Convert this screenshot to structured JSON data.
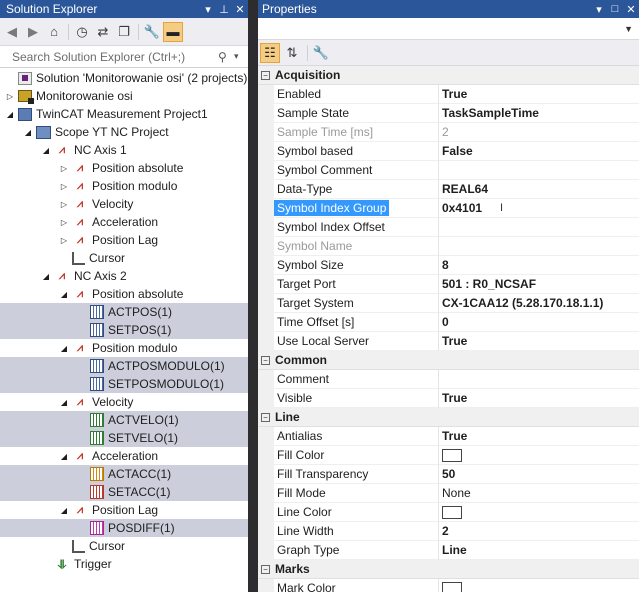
{
  "solution_explorer": {
    "title": "Solution Explorer",
    "pin_icon": "pin-icon",
    "close_icon": "close-icon",
    "search_placeholder": "Search Solution Explorer (Ctrl+;)",
    "tree": [
      {
        "label": "Solution 'Monitorowanie osi' (2 projects)",
        "icon": "solution-icon",
        "level": 0,
        "expander": "none",
        "selected": false
      },
      {
        "label": "Monitorowanie osi",
        "icon": "plc-project-icon",
        "level": 0,
        "expander": "collapsed",
        "selected": false
      },
      {
        "label": "TwinCAT Measurement Project1",
        "icon": "measurement-project-icon",
        "level": 0,
        "expander": "expanded",
        "selected": false
      },
      {
        "label": "Scope YT NC Project",
        "icon": "scope-icon",
        "level": 1,
        "expander": "expanded",
        "selected": false
      },
      {
        "label": "NC Axis 1",
        "icon": "axis-icon",
        "level": 2,
        "expander": "expanded",
        "selected": false
      },
      {
        "label": "Position absolute",
        "icon": "channel-icon",
        "level": 3,
        "expander": "collapsed",
        "selected": false
      },
      {
        "label": "Position modulo",
        "icon": "channel-icon",
        "level": 3,
        "expander": "collapsed",
        "selected": false
      },
      {
        "label": "Velocity",
        "icon": "channel-icon",
        "level": 3,
        "expander": "collapsed",
        "selected": false
      },
      {
        "label": "Acceleration",
        "icon": "channel-icon",
        "level": 3,
        "expander": "collapsed",
        "selected": false
      },
      {
        "label": "Position Lag",
        "icon": "channel-icon",
        "level": 3,
        "expander": "collapsed",
        "selected": false
      },
      {
        "label": "Cursor",
        "icon": "cursor-icon",
        "level": 3,
        "expander": "none",
        "selected": false
      },
      {
        "label": "NC Axis 2",
        "icon": "axis-icon",
        "level": 2,
        "expander": "expanded",
        "selected": false
      },
      {
        "label": "Position absolute",
        "icon": "channel-icon",
        "level": 3,
        "expander": "expanded",
        "selected": false
      },
      {
        "label": "ACTPOS(1)",
        "icon": "acquisition-blue-icon",
        "level": 4,
        "expander": "none",
        "selected": true
      },
      {
        "label": "SETPOS(1)",
        "icon": "acquisition-blue-icon",
        "level": 4,
        "expander": "none",
        "selected": true
      },
      {
        "label": "Position modulo",
        "icon": "channel-icon",
        "level": 3,
        "expander": "expanded",
        "selected": false
      },
      {
        "label": "ACTPOSMODULO(1)",
        "icon": "acquisition-blue-icon",
        "level": 4,
        "expander": "none",
        "selected": true
      },
      {
        "label": "SETPOSMODULO(1)",
        "icon": "acquisition-blue-icon",
        "level": 4,
        "expander": "none",
        "selected": true
      },
      {
        "label": "Velocity",
        "icon": "channel-icon",
        "level": 3,
        "expander": "expanded",
        "selected": false
      },
      {
        "label": "ACTVELO(1)",
        "icon": "acquisition-green-icon",
        "level": 4,
        "expander": "none",
        "selected": true
      },
      {
        "label": "SETVELO(1)",
        "icon": "acquisition-green-icon",
        "level": 4,
        "expander": "none",
        "selected": true
      },
      {
        "label": "Acceleration",
        "icon": "channel-icon",
        "level": 3,
        "expander": "expanded",
        "selected": false
      },
      {
        "label": "ACTACC(1)",
        "icon": "acquisition-orange-icon",
        "level": 4,
        "expander": "none",
        "selected": true
      },
      {
        "label": "SETACC(1)",
        "icon": "acquisition-red-icon",
        "level": 4,
        "expander": "none",
        "selected": true
      },
      {
        "label": "Position Lag",
        "icon": "channel-icon",
        "level": 3,
        "expander": "expanded",
        "selected": false
      },
      {
        "label": "POSDIFF(1)",
        "icon": "acquisition-magenta-icon",
        "level": 4,
        "expander": "none",
        "selected": true
      },
      {
        "label": "Cursor",
        "icon": "cursor-icon",
        "level": 3,
        "expander": "none",
        "selected": false
      },
      {
        "label": "Trigger",
        "icon": "trigger-icon",
        "level": 2,
        "expander": "none",
        "selected": false
      }
    ]
  },
  "properties": {
    "title": "Properties",
    "categories": [
      {
        "name": "Acquisition",
        "rows": [
          {
            "name": "Enabled",
            "value": "True",
            "bold": true
          },
          {
            "name": "Sample State",
            "value": "TaskSampleTime",
            "bold": true
          },
          {
            "name": "Sample Time [ms]",
            "value": "2",
            "bold": false,
            "disabled": true
          },
          {
            "name": "Symbol based",
            "value": "False",
            "bold": true
          },
          {
            "name": "Symbol Comment",
            "value": "",
            "bold": false
          },
          {
            "name": "Data-Type",
            "value": "REAL64",
            "bold": true
          },
          {
            "name": "Symbol Index Group",
            "value": "0x4101",
            "bold": true,
            "selected": true
          },
          {
            "name": "Symbol Index Offset",
            "value": "",
            "bold": false
          },
          {
            "name": "Symbol Name",
            "value": "",
            "bold": false,
            "disabled": true
          },
          {
            "name": "Symbol Size",
            "value": "8",
            "bold": true
          },
          {
            "name": "Target Port",
            "value": "501 : R0_NCSAF",
            "bold": true
          },
          {
            "name": "Target System",
            "value": "CX-1CAA12 (5.28.170.18.1.1)",
            "bold": true
          },
          {
            "name": "Time Offset [s]",
            "value": "0",
            "bold": true
          },
          {
            "name": "Use Local Server",
            "value": "True",
            "bold": true
          }
        ]
      },
      {
        "name": "Common",
        "rows": [
          {
            "name": "Comment",
            "value": "",
            "bold": false
          },
          {
            "name": "Visible",
            "value": "True",
            "bold": true
          }
        ]
      },
      {
        "name": "Line",
        "rows": [
          {
            "name": "Antialias",
            "value": "True",
            "bold": true
          },
          {
            "name": "Fill Color",
            "value": "",
            "swatch": "#ffffff"
          },
          {
            "name": "Fill Transparency",
            "value": "50",
            "bold": true
          },
          {
            "name": "Fill Mode",
            "value": "None",
            "bold": false
          },
          {
            "name": "Line Color",
            "value": "",
            "swatch": "#ffffff"
          },
          {
            "name": "Line Width",
            "value": "2",
            "bold": true
          },
          {
            "name": "Graph Type",
            "value": "Line",
            "bold": true
          }
        ]
      },
      {
        "name": "Marks",
        "rows": [
          {
            "name": "Mark Color",
            "value": "",
            "swatch": "#ffffff"
          }
        ]
      }
    ]
  },
  "colors": {
    "titlebar": "#2b579a",
    "selection": "#3399ff",
    "tree_selection": "#cccedb"
  }
}
